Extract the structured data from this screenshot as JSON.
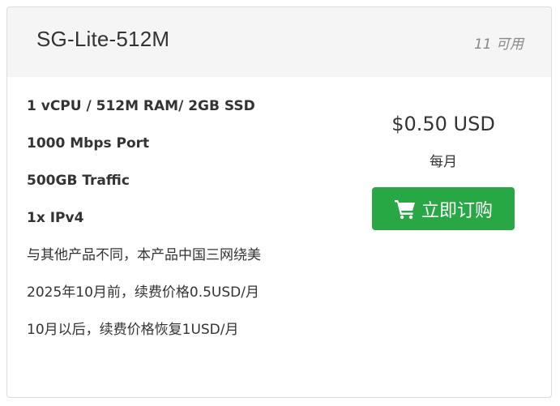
{
  "product": {
    "title": "SG-Lite-512M",
    "availability": "11 可用"
  },
  "features": [
    {
      "text": "1 vCPU / 512M RAM/ 2GB SSD",
      "bold": true
    },
    {
      "text": "1000 Mbps Port",
      "bold": true
    },
    {
      "text": "500GB Traffic",
      "bold": true
    },
    {
      "text": "1x IPv4",
      "bold": true
    },
    {
      "text": "与其他产品不同，本产品中国三网绕美",
      "bold": false
    },
    {
      "text": "2025年10月前，续费价格0.5USD/月",
      "bold": false
    },
    {
      "text": "10月以后，续费价格恢复1USD/月",
      "bold": false
    }
  ],
  "pricing": {
    "price": "$0.50 USD",
    "cycle": "每月",
    "order_label": "立即订购",
    "order_icon": "shopping-cart-icon",
    "button_color": "#28a745"
  }
}
